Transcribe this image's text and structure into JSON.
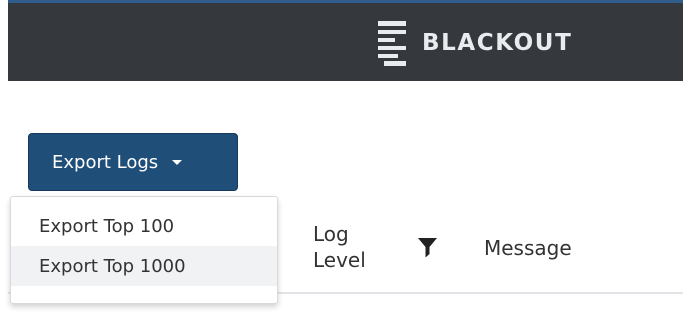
{
  "header": {
    "brand_name": "BLACKOUT",
    "logo_icon": "stacked-bars-logo-icon"
  },
  "toolbar": {
    "export_label": "Export Logs",
    "export_icon": "caret-down-icon"
  },
  "export_menu": {
    "items": [
      {
        "label": "Export Top 100"
      },
      {
        "label": "Export Top 1000"
      }
    ],
    "highlighted_index": 1
  },
  "table": {
    "columns": {
      "log_level": "Log Level",
      "message": "Message"
    },
    "filter_icon": "filter-funnel-icon"
  },
  "colors": {
    "topbar_bg": "#35383c",
    "topbar_accent": "#2f5e8c",
    "primary_button": "#1f4e79",
    "menu_hover": "#f1f2f4"
  }
}
